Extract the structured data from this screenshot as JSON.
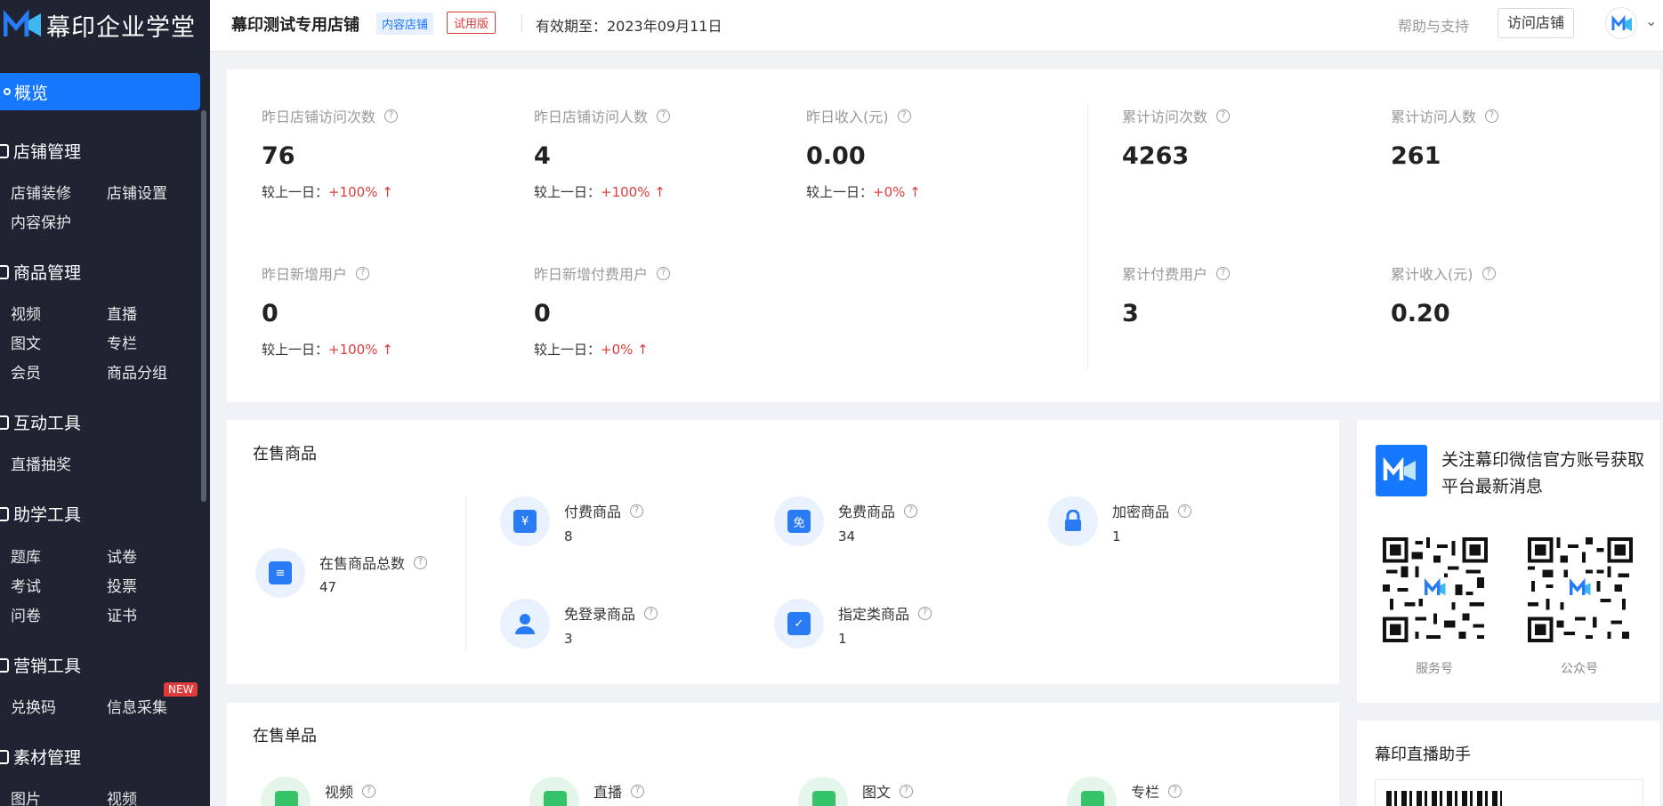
{
  "brand": {
    "name": "幕印企业学堂"
  },
  "sidebar": {
    "active": "概览",
    "groups": [
      {
        "label": "店铺管理",
        "items": [
          "店铺装修",
          "店铺设置",
          "内容保护"
        ]
      },
      {
        "label": "商品管理",
        "items": [
          "视频",
          "直播",
          "图文",
          "专栏",
          "会员",
          "商品分组"
        ]
      },
      {
        "label": "互动工具",
        "items": [
          "直播抽奖"
        ]
      },
      {
        "label": "助学工具",
        "items": [
          "题库",
          "试卷",
          "考试",
          "投票",
          "问卷",
          "证书"
        ]
      },
      {
        "label": "营销工具",
        "items": [
          "兑换码",
          "信息采集"
        ]
      },
      {
        "label": "素材管理",
        "items": [
          "图片",
          "视频"
        ]
      }
    ],
    "new_badge": "NEW"
  },
  "header": {
    "shop_name": "幕印测试专用店铺",
    "tag_content": "内容店铺",
    "tag_trial": "试用版",
    "valid_until": "有效期至：2023年09月11日",
    "help": "帮助与支持",
    "visit_button": "访问店铺"
  },
  "stats": {
    "compare_label": "较上一日：",
    "yesterday_visits": {
      "label": "昨日店铺访问次数",
      "value": "76",
      "change": "+100% ↑"
    },
    "yesterday_visitors": {
      "label": "昨日店铺访问人数",
      "value": "4",
      "change": "+100% ↑"
    },
    "yesterday_income": {
      "label": "昨日收入(元)",
      "value": "0.00",
      "change": "+0% ↑"
    },
    "yesterday_new_users": {
      "label": "昨日新增用户",
      "value": "0",
      "change": "+100% ↑"
    },
    "yesterday_new_paid": {
      "label": "昨日新增付费用户",
      "value": "0",
      "change": "+0% ↑"
    },
    "total_visits": {
      "label": "累计访问次数",
      "value": "4263"
    },
    "total_visitors": {
      "label": "累计访问人数",
      "value": "261"
    },
    "total_paid_users": {
      "label": "累计付费用户",
      "value": "3"
    },
    "total_income": {
      "label": "累计收入(元)",
      "value": "0.20"
    }
  },
  "goods": {
    "title": "在售商品",
    "total": {
      "label": "在售商品总数",
      "value": "47"
    },
    "paid": {
      "label": "付费商品",
      "value": "8",
      "icon": "¥"
    },
    "free": {
      "label": "免费商品",
      "value": "34",
      "icon": "免"
    },
    "encrypted": {
      "label": "加密商品",
      "value": "1"
    },
    "no_login": {
      "label": "免登录商品",
      "value": "3"
    },
    "designated": {
      "label": "指定类商品",
      "value": "1"
    }
  },
  "follow": {
    "text": "关注幕印微信官方账号获取平台最新消息",
    "qr1_label": "服务号",
    "qr2_label": "公众号"
  },
  "single": {
    "title": "在售单品",
    "items": [
      "视频",
      "直播",
      "图文",
      "专栏"
    ]
  },
  "live_helper": {
    "title": "幕印直播助手"
  },
  "colors": {
    "accent": "#1677ff",
    "sidebar_bg": "#1f2332",
    "up": "#e03b3b",
    "green": "#34c368"
  }
}
